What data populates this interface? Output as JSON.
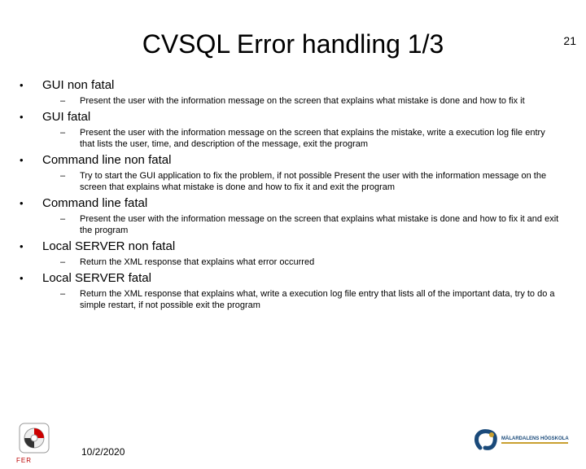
{
  "page_number": "21",
  "title": "CVSQL Error handling 1/3",
  "items": [
    {
      "heading": "GUI non fatal",
      "sub": "Present the user with the information message on the screen that explains what mistake is done and how to fix it"
    },
    {
      "heading": "GUI fatal",
      "sub": "Present the user with the information message on the screen that explains the mistake, write a execution log file entry that lists the user, time, and description of the message, exit the program"
    },
    {
      "heading": "Command line non fatal",
      "sub": "Try to start the GUI application to fix the problem, if not possible Present the user with the information message on the screen that explains what mistake is done and how to fix it and exit the program"
    },
    {
      "heading": "Command line fatal",
      "sub": "Present the user with the information message on the screen that explains what mistake is done and how to fix it and exit the program"
    },
    {
      "heading": "Local SERVER non fatal",
      "sub": "Return the XML response that explains what error occurred"
    },
    {
      "heading": "Local SERVER fatal",
      "sub": "Return the XML response that explains what, write a execution log file entry that lists all of the important data, try to do a simple restart, if not possible exit the program"
    }
  ],
  "footer": {
    "fer": "FER",
    "date": "10/2/2020",
    "right_brand": "MÄLARDALENS HÖGSKOLA"
  }
}
